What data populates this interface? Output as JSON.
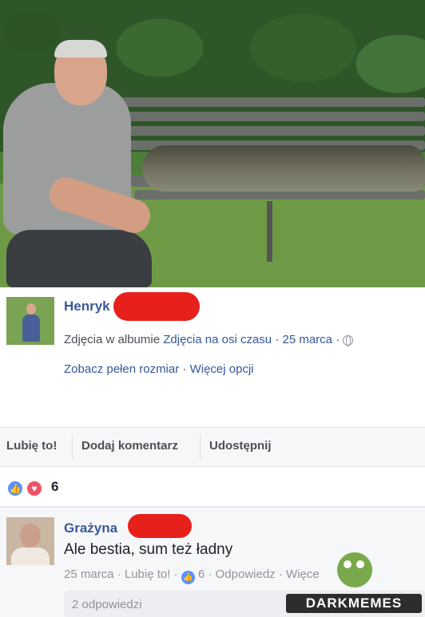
{
  "post": {
    "author_name": "Henryk",
    "album_line_prefix": "Zdjęcia w albumie",
    "album_name": "Zdjęcia na osi czasu",
    "date": "25 marca",
    "separator": "·",
    "full_size_link": "Zobacz pełen rozmiar",
    "more_options_link": "Więcej opcji"
  },
  "actions": {
    "like": "Lubię to!",
    "comment": "Dodaj komentarz",
    "share": "Udostępnij"
  },
  "reactions": {
    "count": "6",
    "like_icon": "like-icon",
    "love_icon": "love-icon",
    "like_glyph": "👍",
    "love_glyph": "♥"
  },
  "comment": {
    "author_name": "Grażyna",
    "text": "Ale bestia, sum też ładny",
    "date": "25 marca",
    "like_link": "Lubię to!",
    "like_count": "6",
    "reply_link": "Odpowiedz",
    "more_link": "Więce",
    "replies_label": "2 odpowiedzi"
  },
  "watermark": {
    "text": "DARKMEMES"
  },
  "colors": {
    "redaction": "#e8201c",
    "link": "#365899",
    "like_blue": "#5890ff",
    "love_red": "#f25268"
  }
}
